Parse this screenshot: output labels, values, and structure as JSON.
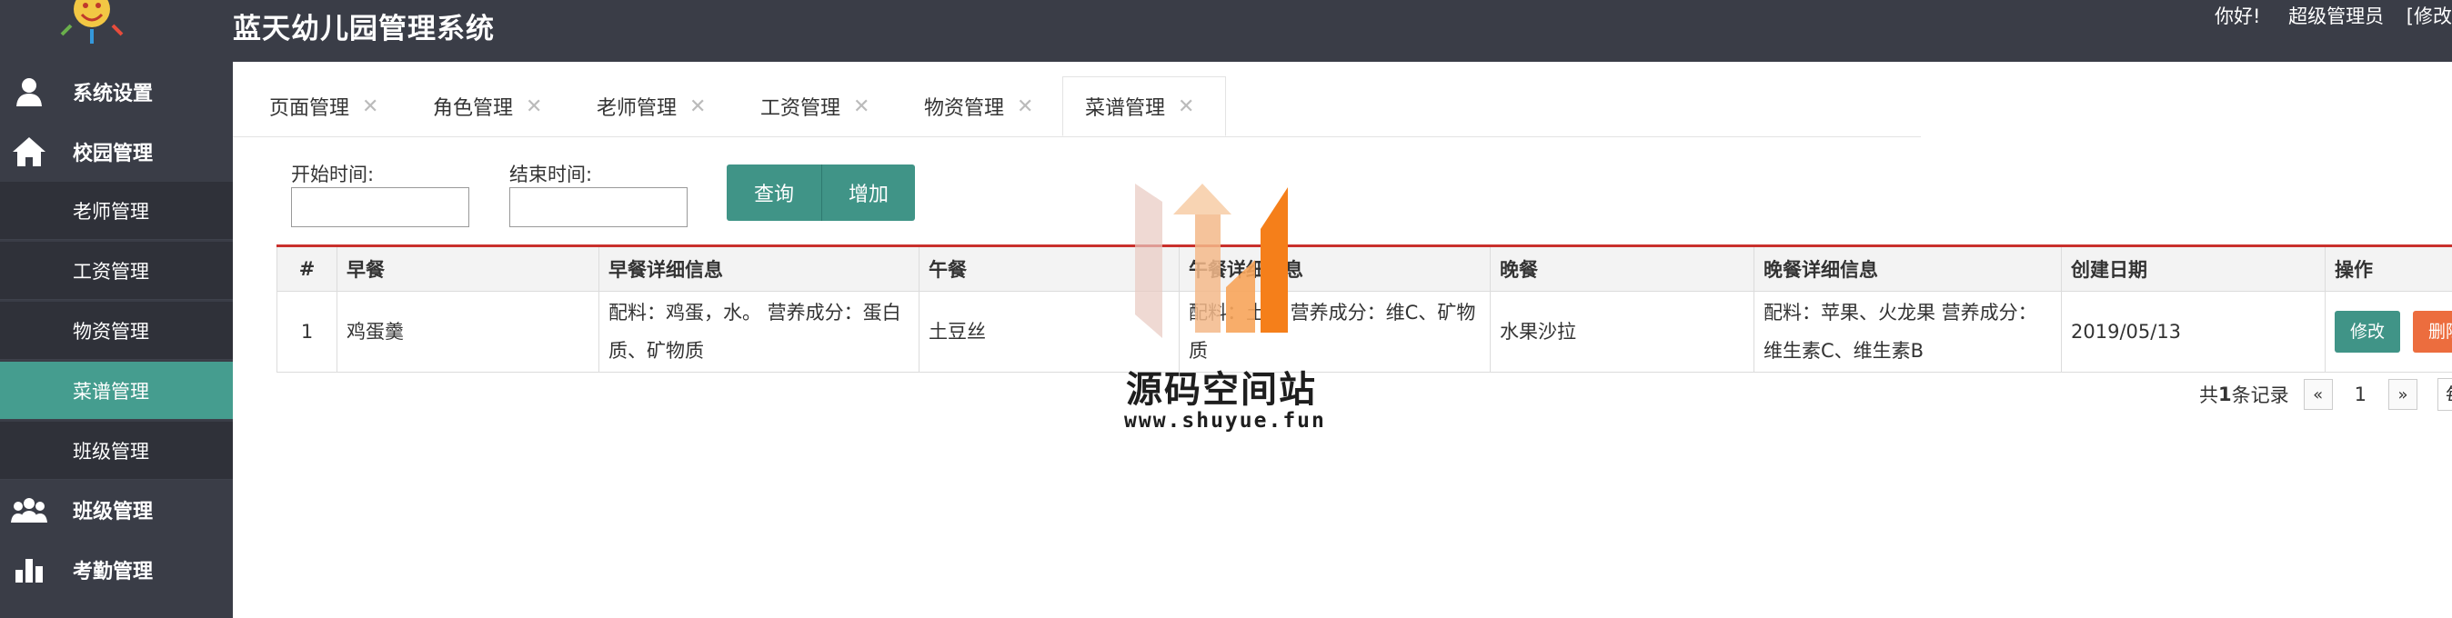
{
  "header": {
    "title": "蓝天幼儿园管理系统",
    "greeting": "你好!",
    "user_role": "超级管理员",
    "action_fragment": "[修改"
  },
  "sidebar": {
    "items": [
      {
        "label": "系统设置",
        "icon": "user-icon"
      },
      {
        "label": "校园管理",
        "icon": "home-icon"
      }
    ],
    "sub_items": [
      {
        "label": "老师管理"
      },
      {
        "label": "工资管理"
      },
      {
        "label": "物资管理"
      },
      {
        "label": "菜谱管理",
        "active": true
      },
      {
        "label": "班级管理"
      }
    ],
    "bottom_items": [
      {
        "label": "班级管理",
        "icon": "group-icon"
      },
      {
        "label": "考勤管理",
        "icon": "bar-chart-icon"
      }
    ]
  },
  "tabs": [
    {
      "label": "页面管理"
    },
    {
      "label": "角色管理"
    },
    {
      "label": "老师管理"
    },
    {
      "label": "工资管理"
    },
    {
      "label": "物资管理"
    },
    {
      "label": "菜谱管理",
      "active": true
    }
  ],
  "search": {
    "start_label": "开始时间:",
    "end_label": "结束时间:",
    "start_value": "",
    "end_value": "",
    "query_label": "查询",
    "add_label": "增加"
  },
  "table": {
    "headers": [
      "#",
      "早餐",
      "早餐详细信息",
      "午餐",
      "午餐详细信息",
      "晚餐",
      "晚餐详细信息",
      "创建日期",
      "操作"
    ],
    "rows": [
      {
        "num": "1",
        "breakfast": "鸡蛋羹",
        "breakfast_detail": "配料：鸡蛋，水。 营养成分：蛋白质、矿物质",
        "lunch": "土豆丝",
        "lunch_detail": "配料：土豆 营养成分：维C、矿物质",
        "dinner": "水果沙拉",
        "dinner_detail": "配料：苹果、火龙果 营养成分：维生素C、维生素B",
        "created": "2019/05/13",
        "edit_label": "修改",
        "delete_label": "删除"
      }
    ]
  },
  "pagination": {
    "total_prefix": "共",
    "total_count": "1",
    "total_suffix": "条记录",
    "prev": "«",
    "page": "1",
    "next": "»",
    "per_page_fragment": "每页"
  },
  "watermark": {
    "title": "源码空间站",
    "url": "www.shuyue.fun"
  },
  "colors": {
    "topbar": "#3a3d47",
    "accent": "#409487",
    "danger": "#ec6d3e",
    "table_top_border": "#c9302c"
  }
}
